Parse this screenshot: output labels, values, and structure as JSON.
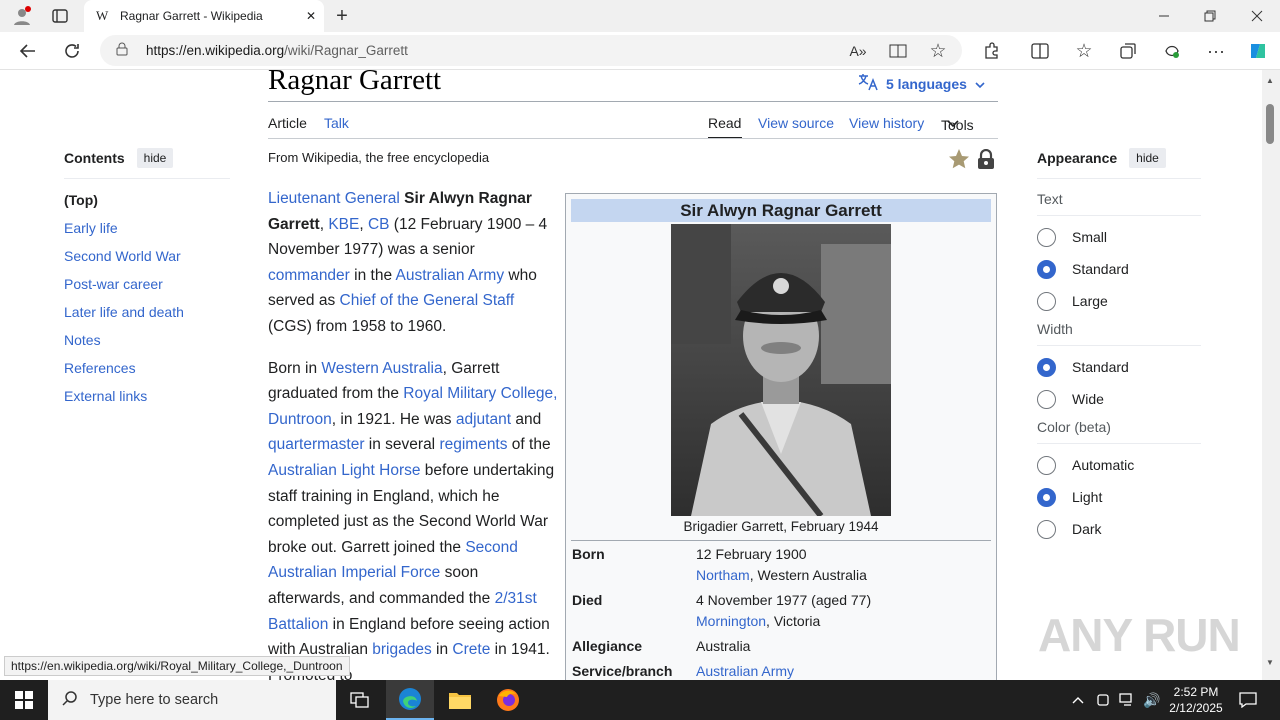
{
  "browser": {
    "tab_title": "Ragnar Garrett - Wikipedia",
    "tab_icon": "W",
    "url_domain": "https://en.wikipedia.org",
    "url_path": "/wiki/Ragnar_Garrett",
    "status_url": "https://en.wikipedia.org/wiki/Royal_Military_College,_Duntroon"
  },
  "article": {
    "title": "Ragnar Garrett",
    "languages": "5 languages",
    "tabs_left": [
      "Article",
      "Talk"
    ],
    "tabs_right": [
      "Read",
      "View source",
      "View history",
      "Tools"
    ],
    "from": "From Wikipedia, the free encyclopedia"
  },
  "toc": {
    "heading": "Contents",
    "hide": "hide",
    "items": [
      "(Top)",
      "Early life",
      "Second World War",
      "Post-war career",
      "Later life and death",
      "Notes",
      "References",
      "External links"
    ]
  },
  "infobox": {
    "title": "Sir Alwyn Ragnar Garrett",
    "caption": "Brigadier Garrett, February 1944",
    "born_label": "Born",
    "born_date": "12 February 1900",
    "born_place_link": "Northam",
    "born_place_rest": ", Western Australia",
    "died_label": "Died",
    "died_date": "4 November 1977 (aged 77)",
    "died_place_link": "Mornington",
    "died_place_rest": ", Victoria",
    "allegiance_label": "Allegiance",
    "allegiance": "Australia",
    "branch_label": "Service/branch",
    "branch": "Australian Army"
  },
  "appearance": {
    "heading": "Appearance",
    "hide": "hide",
    "text_label": "Text",
    "text_options": [
      "Small",
      "Standard",
      "Large"
    ],
    "text_selected": "Standard",
    "width_label": "Width",
    "width_options": [
      "Standard",
      "Wide"
    ],
    "width_selected": "Standard",
    "color_label": "Color (beta)",
    "color_options": [
      "Automatic",
      "Light",
      "Dark"
    ],
    "color_selected": "Light"
  },
  "taskbar": {
    "search_placeholder": "Type here to search",
    "time": "2:52 PM",
    "date": "2/12/2025"
  },
  "watermark": "ANY RUN",
  "colors": {
    "link": "#3366cc",
    "infobox_header": "#c4d6f0",
    "taskbar": "#1f1f1f"
  }
}
